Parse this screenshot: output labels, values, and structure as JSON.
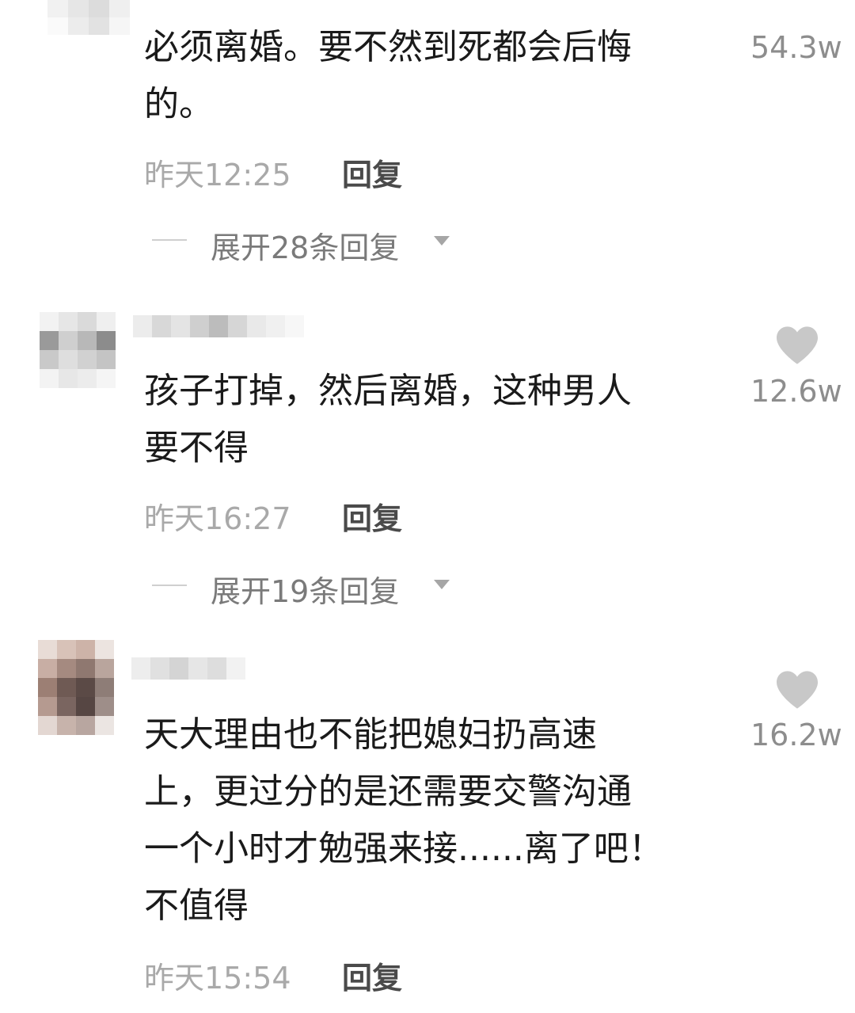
{
  "comments": [
    {
      "lines": [
        "必须离婚。要不然到死都会后悔",
        "的。"
      ],
      "likes": "54.3w",
      "time": "昨天12:25",
      "reply": "回复",
      "expand": "展开28条回复"
    },
    {
      "lines": [
        "孩子打掉，然后离婚，这种男人",
        "要不得"
      ],
      "likes": "12.6w",
      "time": "昨天16:27",
      "reply": "回复",
      "expand": "展开19条回复"
    },
    {
      "lines": [
        "天大理由也不能把媳妇扔高速",
        "上，更过分的是还需要交警沟通",
        "一个小时才勉强来接......离了吧！",
        "不值得"
      ],
      "likes": "16.2w",
      "time": "昨天15:54",
      "reply": "回复"
    }
  ],
  "icons": {
    "like": "heart-icon",
    "expand": "triangle-down-icon"
  },
  "colors": {
    "text": "#1a1a1a",
    "meta": "#a9a9a9",
    "likes": "#8d8d8d",
    "heart": "#c8c8c8"
  }
}
